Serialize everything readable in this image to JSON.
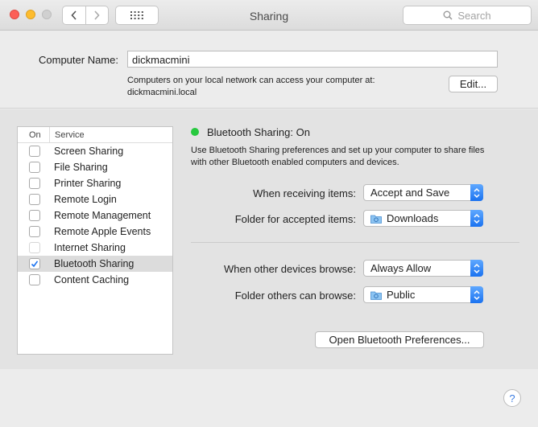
{
  "window": {
    "title": "Sharing",
    "search_placeholder": "Search"
  },
  "computer": {
    "name_label": "Computer Name:",
    "name_value": "dickmacmini",
    "help_line1": "Computers on your local network can access your computer at:",
    "help_line2": "dickmacmini.local",
    "edit_label": "Edit..."
  },
  "services": {
    "col_on": "On",
    "col_service": "Service",
    "items": [
      {
        "label": "Screen Sharing",
        "checked": false
      },
      {
        "label": "File Sharing",
        "checked": false
      },
      {
        "label": "Printer Sharing",
        "checked": false
      },
      {
        "label": "Remote Login",
        "checked": false
      },
      {
        "label": "Remote Management",
        "checked": false
      },
      {
        "label": "Remote Apple Events",
        "checked": false
      },
      {
        "label": "Internet Sharing",
        "checked": false
      },
      {
        "label": "Bluetooth Sharing",
        "checked": true
      },
      {
        "label": "Content Caching",
        "checked": false
      }
    ],
    "selected_index": 7
  },
  "detail": {
    "status": "Bluetooth Sharing: On",
    "status_color": "#27c93f",
    "desc_line1": "Use Bluetooth Sharing preferences and set up your computer to share files",
    "desc_line2": "with other Bluetooth enabled computers and devices.",
    "receiving_label": "When receiving items:",
    "receiving_value": "Accept and Save",
    "folder_accepted_label": "Folder for accepted items:",
    "folder_accepted_value": "Downloads",
    "browse_label": "When other devices browse:",
    "browse_value": "Always Allow",
    "folder_browse_label": "Folder others can browse:",
    "folder_browse_value": "Public",
    "open_prefs_label": "Open Bluetooth Preferences..."
  },
  "help_label": "?",
  "accent_color": "#1a72f0"
}
